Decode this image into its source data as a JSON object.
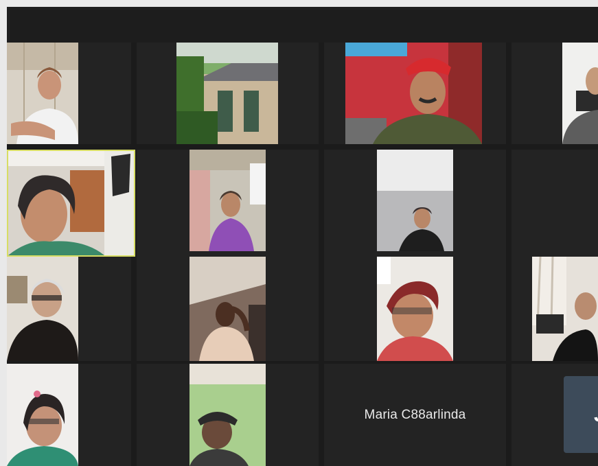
{
  "meeting": {
    "toolbar_label": "",
    "grid_columns": 4,
    "grid_rows": 4
  },
  "participants": [
    {
      "id": "p1",
      "video": true,
      "speaking": false
    },
    {
      "id": "p2",
      "video": true,
      "speaking": false
    },
    {
      "id": "p3",
      "video": true,
      "speaking": false
    },
    {
      "id": "p4",
      "video": true,
      "speaking": false
    },
    {
      "id": "p5",
      "video": true,
      "speaking": true
    },
    {
      "id": "p6",
      "video": true,
      "speaking": false
    },
    {
      "id": "p7",
      "video": true,
      "speaking": false
    },
    {
      "id": "p8",
      "video": false,
      "speaking": false
    },
    {
      "id": "p9",
      "video": true,
      "speaking": false
    },
    {
      "id": "p10",
      "video": true,
      "speaking": false
    },
    {
      "id": "p11",
      "video": true,
      "speaking": false
    },
    {
      "id": "p12",
      "video": true,
      "speaking": false
    },
    {
      "id": "p13",
      "video": true,
      "speaking": false
    },
    {
      "id": "p14",
      "video": true,
      "speaking": false
    },
    {
      "id": "p15",
      "video": false,
      "speaking": false,
      "name": "Maria C88arlinda"
    },
    {
      "id": "p16",
      "video": false,
      "speaking": false,
      "initial": "J",
      "avatar_color": "#3d4b5a"
    }
  ],
  "colors": {
    "grid_background": "#1b1b1b",
    "tile_background": "#232323",
    "active_speaker_border": "#d7dd63",
    "name_text": "#e9e9e9"
  }
}
